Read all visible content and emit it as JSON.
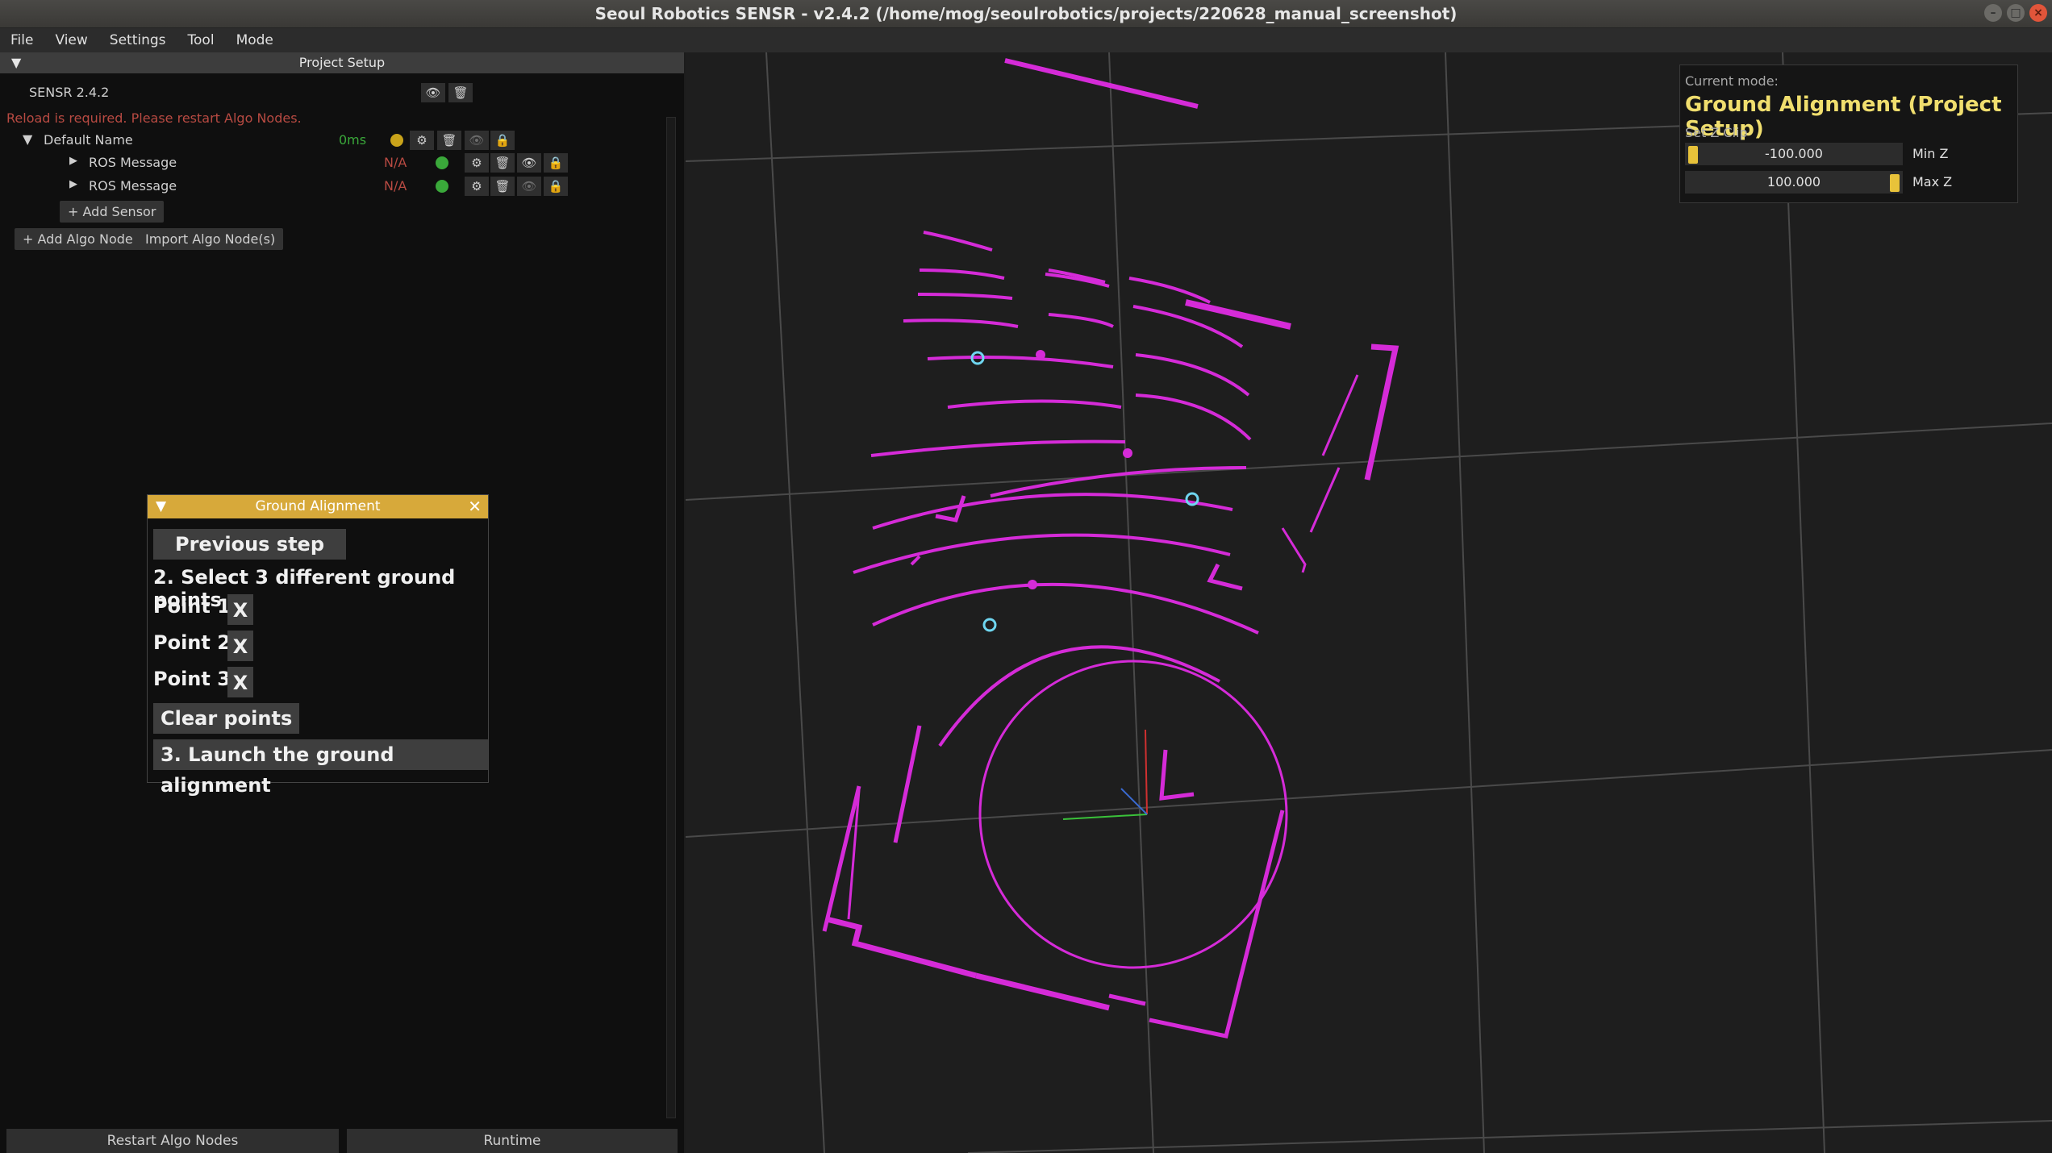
{
  "window": {
    "title": "Seoul Robotics SENSR - v2.4.2 (/home/mog/seoulrobotics/projects/220628_manual_screenshot)",
    "buttons": [
      "minimize-icon",
      "maximize-icon",
      "close-icon"
    ]
  },
  "menubar": {
    "items": [
      "File",
      "View",
      "Settings",
      "Tool",
      "Mode"
    ]
  },
  "left_panel": {
    "header": "Project Setup",
    "version_label": "SENSR 2.4.2",
    "warning": "Reload is required. Please restart Algo Nodes.",
    "algo_node": {
      "name": "Default Name",
      "latency": "0ms",
      "status_color": "#c9a31a"
    },
    "sensors": [
      {
        "name": "ROS Message",
        "latency": "N/A",
        "status_color": "#3aa83a"
      },
      {
        "name": "ROS Message",
        "latency": "N/A",
        "status_color": "#3aa83a"
      }
    ],
    "add_sensor": "+ Add Sensor",
    "add_algo_node": "+ Add Algo Node",
    "import_algo_nodes": "Import Algo Node(s)",
    "restart_button": "Restart Algo Nodes",
    "runtime_button": "Runtime"
  },
  "ground_alignment": {
    "title": "Ground Alignment",
    "previous_step": "Previous step",
    "instruction": "2. Select 3 different ground points",
    "points": [
      "Point 1",
      "Point 2",
      "Point 3"
    ],
    "remove_label": "X",
    "clear_points": "Clear points",
    "launch": "3. Launch the ground alignment"
  },
  "mode_panel": {
    "label": "Current mode:",
    "title": "Ground Alignment (Project Setup)",
    "z_clip_label": "Set Z Clip",
    "min_z": {
      "value": "-100.000",
      "label": "Min Z"
    },
    "max_z": {
      "value": "100.000",
      "label": "Max Z"
    }
  },
  "colors": {
    "accent": "#d7a93a",
    "mode_title": "#f0de6e",
    "point_cloud": "#d52bd8",
    "selected_point": "#6fd6f0",
    "warning_text": "#b84a42"
  }
}
